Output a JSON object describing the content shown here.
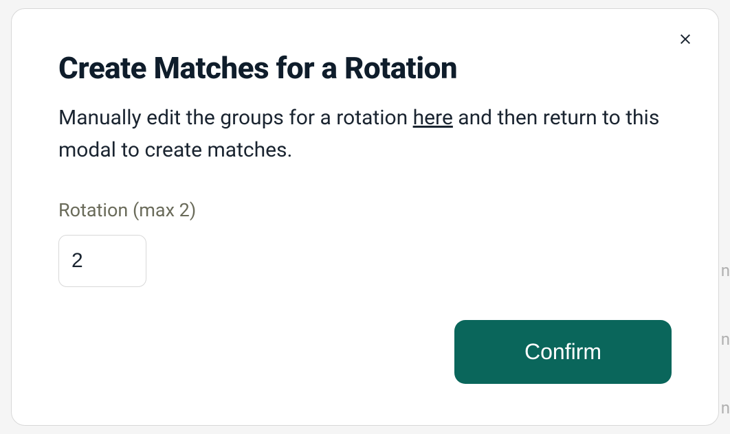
{
  "modal": {
    "title": "Create Matches for a Rotation",
    "description_part1": "Manually edit the groups for a rotation ",
    "description_link": "here",
    "description_part2": " and then return to this modal to create matches.",
    "field_label": "Rotation (max 2)",
    "rotation_value": "2",
    "confirm_label": "Confirm"
  }
}
